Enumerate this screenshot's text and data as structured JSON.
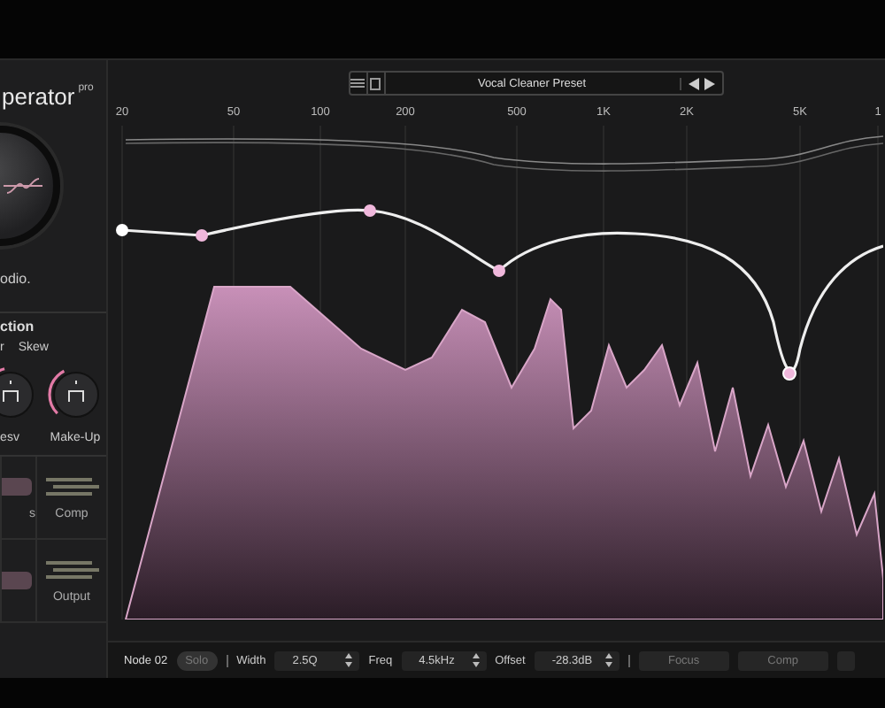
{
  "left_panel": {
    "title": "perator",
    "title_badge": "pro",
    "brand": "odio.",
    "section_title": "ction",
    "param_labels": [
      "r",
      "Skew"
    ],
    "knobs": [
      {
        "label": "esv",
        "level": 0.45
      },
      {
        "label": "Make-Up",
        "level": 0.4
      }
    ],
    "modules": [
      {
        "kind": "labeled",
        "label": "s"
      },
      {
        "kind": "labeled",
        "label": "Comp"
      },
      {
        "kind": "plain"
      },
      {
        "kind": "labeled",
        "label": "Output"
      }
    ]
  },
  "preset_bar": {
    "name": "Vocal Cleaner Preset"
  },
  "freq_axis": [
    "20",
    "50",
    "100",
    "200",
    "500",
    "1K",
    "2K",
    "5K",
    "1"
  ],
  "node_bar": {
    "node": "Node 02",
    "solo": {
      "label": "Solo",
      "on": false
    },
    "fields": [
      {
        "label": "Width",
        "value": "2.5Q"
      },
      {
        "label": "Freq",
        "value": "4.5kHz"
      },
      {
        "label": "Offset",
        "value": "-28.3dB"
      }
    ],
    "buttons": [
      "Focus",
      "Comp"
    ]
  }
}
